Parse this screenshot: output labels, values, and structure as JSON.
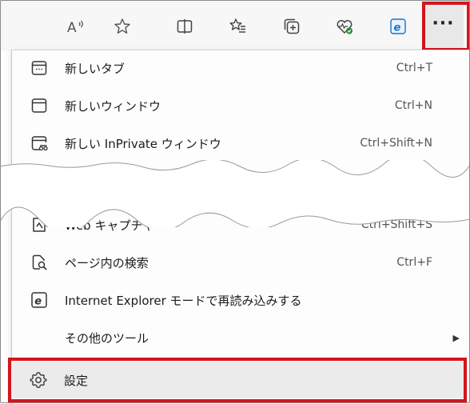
{
  "toolbar": {
    "icons": [
      "read-aloud-icon",
      "favorite-star-icon",
      "split-screen-icon",
      "favorites-list-icon",
      "collections-icon",
      "browser-essentials-icon",
      "ie-mode-icon"
    ],
    "more_label": "···"
  },
  "menu": {
    "items": [
      {
        "label": "新しいタブ",
        "shortcut": "Ctrl+T",
        "icon": "new-tab-icon"
      },
      {
        "label": "新しいウィンドウ",
        "shortcut": "Ctrl+N",
        "icon": "new-window-icon"
      },
      {
        "label": "新しい InPrivate ウィンドウ",
        "shortcut": "Ctrl+Shift+N",
        "icon": "inprivate-window-icon"
      },
      {
        "label": "Web キャプチャ",
        "shortcut": "Ctrl+Shift+S",
        "icon": "web-capture-icon"
      },
      {
        "label": "ページ内の検索",
        "shortcut": "Ctrl+F",
        "icon": "find-on-page-icon"
      },
      {
        "label": "Internet Explorer モードで再読み込みする",
        "shortcut": "",
        "icon": "ie-reload-icon"
      },
      {
        "label": "その他のツール",
        "shortcut": "",
        "icon": "",
        "submenu": true
      },
      {
        "label": "設定",
        "shortcut": "",
        "icon": "settings-gear-icon"
      }
    ],
    "submenu_arrow": "▶"
  },
  "colors": {
    "highlight": "#d4141c",
    "toolbar_bg": "#f7f7f7",
    "menu_bg": "#fdfdfd",
    "settings_bg": "#ebebeb"
  }
}
